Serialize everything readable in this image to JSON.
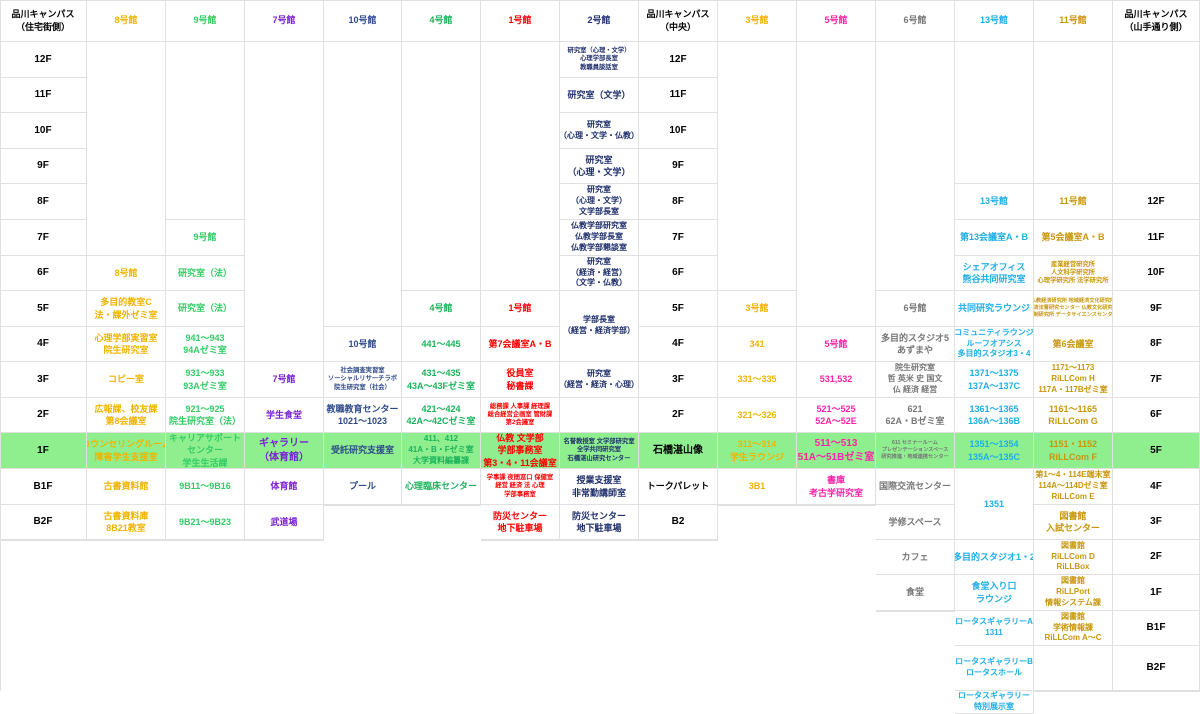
{
  "colors": {
    "b8": "#f0b400",
    "b9": "#33cc66",
    "b7": "#7a1fd6",
    "b10": "#2e4a8a",
    "b4": "#1bb35c",
    "b1": "#ff0000",
    "b2": "#1f2f6b",
    "b3": "#f0b400",
    "b5": "#ff22a8",
    "b6": "#777777",
    "b13": "#1eaee6",
    "b11": "#c8960a",
    "black": "#000000",
    "band": "#8fef8f",
    "grid": "#e0e0e0"
  },
  "columns": [
    {
      "key": "west_floor",
      "header": "品川キャンパス\n（住宅街側）",
      "color": "black"
    },
    {
      "key": "b8",
      "header": "8号館",
      "color": "b8"
    },
    {
      "key": "b9",
      "header": "9号館",
      "color": "b9"
    },
    {
      "key": "b7",
      "header": "7号館",
      "color": "b7"
    },
    {
      "key": "b10",
      "header": "10号館",
      "color": "b10"
    },
    {
      "key": "b4",
      "header": "4号館",
      "color": "b4"
    },
    {
      "key": "b1",
      "header": "1号館",
      "color": "b1"
    },
    {
      "key": "b2",
      "header": "2号館",
      "color": "b2"
    },
    {
      "key": "center_floor",
      "header": "品川キャンパス\n（中央）",
      "color": "black"
    },
    {
      "key": "b3",
      "header": "3号館",
      "color": "b3"
    },
    {
      "key": "b5",
      "header": "5号館",
      "color": "b5"
    },
    {
      "key": "b6",
      "header": "6号館",
      "color": "b6"
    },
    {
      "key": "b13",
      "header": "13号館",
      "color": "b13"
    },
    {
      "key": "b11",
      "header": "11号館",
      "color": "b11"
    },
    {
      "key": "east_floor",
      "header": "品川キャンパス\n（山手通り側）",
      "color": "black"
    }
  ],
  "cells": [
    {
      "col": 0,
      "row": 1,
      "text": "12F",
      "size": "lg"
    },
    {
      "col": 0,
      "row": 2,
      "text": "11F",
      "size": "lg"
    },
    {
      "col": 0,
      "row": 3,
      "text": "10F",
      "size": "lg"
    },
    {
      "col": 0,
      "row": 4,
      "text": "9F",
      "size": "lg"
    },
    {
      "col": 0,
      "row": 5,
      "text": "8F",
      "size": "lg"
    },
    {
      "col": 0,
      "row": 6,
      "text": "7F",
      "size": "lg"
    },
    {
      "col": 0,
      "row": 7,
      "text": "6F",
      "size": "lg"
    },
    {
      "col": 0,
      "row": 8,
      "text": "5F",
      "size": "lg"
    },
    {
      "col": 0,
      "row": 9,
      "text": "4F",
      "size": "lg"
    },
    {
      "col": 0,
      "row": 10,
      "text": "3F",
      "size": "lg"
    },
    {
      "col": 0,
      "row": 11,
      "text": "2F",
      "size": "lg"
    },
    {
      "col": 0,
      "row": 12,
      "text": "1F",
      "size": "lg"
    },
    {
      "col": 0,
      "row": 13,
      "text": "B1F",
      "size": "lg"
    },
    {
      "col": 0,
      "row": 14,
      "text": "B2F",
      "size": "lg"
    },
    {
      "col": 0,
      "row": 15,
      "rowspan": 5,
      "text": ""
    },
    {
      "col": 1,
      "row": 1,
      "rowspan": 6,
      "text": ""
    },
    {
      "col": 1,
      "row": 7,
      "text": "8号館"
    },
    {
      "col": 1,
      "row": 8,
      "text": "多目的教室C\n法・課外ゼミ室"
    },
    {
      "col": 1,
      "row": 9,
      "text": "心理学部実習室\n院生研究室"
    },
    {
      "col": 1,
      "row": 10,
      "text": "コピー室"
    },
    {
      "col": 1,
      "row": 11,
      "text": "広報課、校友課\n第8会議室"
    },
    {
      "col": 1,
      "row": 12,
      "text": "カウンセリングルーム\n障害学生支援室"
    },
    {
      "col": 1,
      "row": 13,
      "text": "古書資料館"
    },
    {
      "col": 1,
      "row": 14,
      "text": "古書資料庫\n8B21教室"
    },
    {
      "col": 1,
      "row": 15,
      "rowspan": 5,
      "text": ""
    },
    {
      "col": 2,
      "row": 1,
      "rowspan": 5,
      "text": ""
    },
    {
      "col": 2,
      "row": 6,
      "text": "9号館"
    },
    {
      "col": 2,
      "row": 7,
      "text": "研究室（法）"
    },
    {
      "col": 2,
      "row": 8,
      "text": "研究室（法）"
    },
    {
      "col": 2,
      "row": 9,
      "text": "941〜943\n94Aゼミ室"
    },
    {
      "col": 2,
      "row": 10,
      "text": "931〜933\n93Aゼミ室"
    },
    {
      "col": 2,
      "row": 11,
      "text": "921〜925\n院生研究室（法）"
    },
    {
      "col": 2,
      "row": 12,
      "text": "キャリアサポート\nセンター\n学生生活課"
    },
    {
      "col": 2,
      "row": 13,
      "text": "9B11〜9B16"
    },
    {
      "col": 2,
      "row": 14,
      "text": "9B21〜9B23"
    },
    {
      "col": 2,
      "row": 15,
      "rowspan": 5,
      "text": ""
    },
    {
      "col": 3,
      "row": 1,
      "rowspan": 9,
      "text": ""
    },
    {
      "col": 3,
      "row": 10,
      "text": "7号館"
    },
    {
      "col": 3,
      "row": 11,
      "text": "学生食堂"
    },
    {
      "col": 3,
      "row": 12,
      "text": "ギャラリー\n（体育館）",
      "size": "lg"
    },
    {
      "col": 3,
      "row": 13,
      "text": "体育館"
    },
    {
      "col": 3,
      "row": 14,
      "text": "武道場"
    },
    {
      "col": 3,
      "row": 15,
      "rowspan": 5,
      "text": ""
    },
    {
      "col": 4,
      "row": 1,
      "rowspan": 8,
      "text": ""
    },
    {
      "col": 4,
      "row": 9,
      "text": "10号館"
    },
    {
      "col": 4,
      "row": 10,
      "text": "社会調査実習室\nソーシャルリサーチラボ\n院生研究室（社会）",
      "size": "xs"
    },
    {
      "col": 4,
      "row": 11,
      "text": "教職教育センター\n1021〜1023"
    },
    {
      "col": 4,
      "row": 12,
      "text": "受託研究支援室"
    },
    {
      "col": 4,
      "row": 13,
      "text": "プール"
    },
    {
      "col": 4,
      "row": 14,
      "rowspan": 6,
      "text": ""
    },
    {
      "col": 5,
      "row": 1,
      "rowspan": 7,
      "text": ""
    },
    {
      "col": 5,
      "row": 8,
      "text": "4号館"
    },
    {
      "col": 5,
      "row": 9,
      "text": "441〜445"
    },
    {
      "col": 5,
      "row": 10,
      "text": "431〜435\n43A〜43Fゼミ室"
    },
    {
      "col": 5,
      "row": 11,
      "text": "421〜424\n42A〜42Cゼミ室"
    },
    {
      "col": 5,
      "row": 12,
      "text": "411、412\n41A・B・Fゼミ室\n大学資料編纂課",
      "size": "sm"
    },
    {
      "col": 5,
      "row": 13,
      "text": "心理臨床センター"
    },
    {
      "col": 5,
      "row": 14,
      "rowspan": 6,
      "text": ""
    },
    {
      "col": 6,
      "row": 1,
      "rowspan": 7,
      "text": ""
    },
    {
      "col": 6,
      "row": 8,
      "text": "1号館"
    },
    {
      "col": 6,
      "row": 9,
      "text": "第7会議室A・B"
    },
    {
      "col": 6,
      "row": 10,
      "text": "役員室\n秘書課"
    },
    {
      "col": 6,
      "row": 11,
      "text": "総務課 人事課 経理課\n総合経営企画室 管財課\n第2会議室",
      "size": "xs"
    },
    {
      "col": 6,
      "row": 12,
      "text": "仏教 文学部\n学部事務室\n第3・4・11会議室"
    },
    {
      "col": 6,
      "row": 13,
      "text": "学事課 夜間窓口 保健室\n経営 経済 法 心理\n学部事務室",
      "size": "xs"
    },
    {
      "col": 6,
      "row": 14,
      "text": "防災センター\n地下駐車場"
    },
    {
      "col": 6,
      "row": 15,
      "rowspan": 5,
      "text": ""
    },
    {
      "col": 7,
      "row": 1,
      "text": "研究室（心理・文学）\n心理学部長室\n教職員談話室",
      "size": "xs"
    },
    {
      "col": 7,
      "row": 2,
      "text": "研究室（文学）"
    },
    {
      "col": 7,
      "row": 3,
      "text": "研究室\n（心理・文学・仏教）",
      "size": "sm"
    },
    {
      "col": 7,
      "row": 4,
      "text": "研究室\n（心理・文学）"
    },
    {
      "col": 7,
      "row": 5,
      "text": "研究室\n（心理・文学）\n文学部長室",
      "size": "sm"
    },
    {
      "col": 7,
      "row": 6,
      "text": "仏教学部研究室\n仏教学部長室\n仏教学部懇談室",
      "size": "sm"
    },
    {
      "col": 7,
      "row": 7,
      "text": "研究室\n（経済・経営）\n（文学・仏教）",
      "size": "sm"
    },
    {
      "col": 7,
      "row": 8,
      "rowspan": 2,
      "text": "学部長室\n（経営・経済学部）",
      "size": "sm"
    },
    {
      "col": 7,
      "row": 10,
      "text": "研究室\n（経営・経済・心理）",
      "size": "sm"
    },
    {
      "col": 7,
      "row": 11,
      "text": ""
    },
    {
      "col": 7,
      "row": 12,
      "text": "名誉教授室 文学部研究室\n全学共同研究室\n石橋湛山研究センター",
      "size": "xs"
    },
    {
      "col": 7,
      "row": 13,
      "text": "授業支援室\n非常勤講師室"
    },
    {
      "col": 7,
      "row": 14,
      "text": "防災センター\n地下駐車場"
    },
    {
      "col": 7,
      "row": 15,
      "rowspan": 5,
      "text": ""
    },
    {
      "col": 8,
      "row": 1,
      "text": "12F",
      "size": "lg"
    },
    {
      "col": 8,
      "row": 2,
      "text": "11F",
      "size": "lg"
    },
    {
      "col": 8,
      "row": 3,
      "text": "10F",
      "size": "lg"
    },
    {
      "col": 8,
      "row": 4,
      "text": "9F",
      "size": "lg"
    },
    {
      "col": 8,
      "row": 5,
      "text": "8F",
      "size": "lg"
    },
    {
      "col": 8,
      "row": 6,
      "text": "7F",
      "size": "lg"
    },
    {
      "col": 8,
      "row": 7,
      "text": "6F",
      "size": "lg"
    },
    {
      "col": 8,
      "row": 8,
      "text": "5F",
      "size": "lg"
    },
    {
      "col": 8,
      "row": 9,
      "text": "4F",
      "size": "lg"
    },
    {
      "col": 8,
      "row": 10,
      "text": "3F",
      "size": "lg"
    },
    {
      "col": 8,
      "row": 11,
      "text": "2F",
      "size": "lg"
    },
    {
      "col": 8,
      "row": 12,
      "text": "石橋湛山像",
      "size": "lg"
    },
    {
      "col": 8,
      "row": 13,
      "text": "トークパレット"
    },
    {
      "col": 8,
      "row": 14,
      "text": "B2",
      "size": "lg"
    },
    {
      "col": 8,
      "row": 15,
      "rowspan": 5,
      "text": ""
    },
    {
      "col": 9,
      "row": 1,
      "rowspan": 7,
      "text": ""
    },
    {
      "col": 9,
      "row": 8,
      "text": "3号館"
    },
    {
      "col": 9,
      "row": 9,
      "text": "341"
    },
    {
      "col": 9,
      "row": 10,
      "text": "331〜335"
    },
    {
      "col": 9,
      "row": 11,
      "text": "321〜326"
    },
    {
      "col": 9,
      "row": 12,
      "text": "311〜314\n学生ラウンジ"
    },
    {
      "col": 9,
      "row": 13,
      "text": "3B1"
    },
    {
      "col": 9,
      "row": 14,
      "rowspan": 6,
      "text": ""
    },
    {
      "col": 10,
      "row": 1,
      "rowspan": 8,
      "text": ""
    },
    {
      "col": 10,
      "row": 9,
      "text": "5号館"
    },
    {
      "col": 10,
      "row": 10,
      "text": "531,532"
    },
    {
      "col": 10,
      "row": 11,
      "text": "521〜525\n52A〜52E"
    },
    {
      "col": 10,
      "row": 12,
      "text": "511〜513\n51A〜51Bゼミ室",
      "size": "lg"
    },
    {
      "col": 10,
      "row": 13,
      "text": "書庫\n考古学研究室"
    },
    {
      "col": 10,
      "row": 14,
      "rowspan": 6,
      "text": ""
    },
    {
      "col": 11,
      "row": 1,
      "rowspan": 7,
      "text": ""
    },
    {
      "col": 11,
      "row": 8,
      "text": "6号館"
    },
    {
      "col": 11,
      "row": 9,
      "text": "多目的スタジオ5\nあずまや"
    },
    {
      "col": 11,
      "row": 10,
      "text": "院生研究室\n哲 英米 史 国文\n仏 経済 経営",
      "size": "sm"
    },
    {
      "col": 11,
      "row": 11,
      "text": "621\n62A・Bゼミ室"
    },
    {
      "col": 11,
      "row": 12,
      "text": "611 セミナールーム\nプレゼンテーションスペース\n研究推進・地域連携センター",
      "size": "xxs"
    },
    {
      "col": 11,
      "row": 13,
      "text": "国際交流センター"
    },
    {
      "col": 11,
      "row": 14,
      "text": "学修スペース"
    },
    {
      "col": 11,
      "row": 15,
      "text": "カフェ"
    },
    {
      "col": 11,
      "row": 16,
      "text": "食堂"
    },
    {
      "col": 11,
      "row": 17,
      "rowspan": 3,
      "text": ""
    },
    {
      "col": 12,
      "row": 1,
      "rowspan": 4,
      "text": ""
    },
    {
      "col": 12,
      "row": 5,
      "text": "13号館"
    },
    {
      "col": 12,
      "row": 6,
      "text": "第13会議室A・B"
    },
    {
      "col": 12,
      "row": 7,
      "text": "シェアオフィス\n熊谷共同研究室"
    },
    {
      "col": 12,
      "row": 8,
      "text": "共同研究ラウンジ"
    },
    {
      "col": 12,
      "row": 9,
      "text": "コミュニティラウンジ\nルーフオアシス\n多目的スタジオ3・4",
      "size": "sm"
    },
    {
      "col": 12,
      "row": 10,
      "text": "1371〜1375\n137A〜137C"
    },
    {
      "col": 12,
      "row": 11,
      "text": "1361〜1365\n136A〜136B"
    },
    {
      "col": 12,
      "row": 12,
      "text": "1351〜1354\n135A〜135C"
    },
    {
      "col": 12,
      "row": 13,
      "rowspan": 2,
      "text": "1351"
    },
    {
      "col": 12,
      "row": 15,
      "text": "多目的スタジオ1・2"
    },
    {
      "col": 12,
      "row": 16,
      "text": "食堂入り口\nラウンジ"
    },
    {
      "col": 12,
      "row": 17,
      "text": "ロータスギャラリーA\n1311",
      "size": "sm"
    },
    {
      "col": 12,
      "row": 18,
      "text": "ロータスギャラリーB\nロータスホール",
      "size": "sm"
    },
    {
      "col": 12,
      "row": 19,
      "text": "ロータスギャラリー\n特別展示室",
      "size": "sm"
    },
    {
      "col": 13,
      "row": 1,
      "rowspan": 4,
      "text": ""
    },
    {
      "col": 13,
      "row": 5,
      "text": "11号館"
    },
    {
      "col": 13,
      "row": 6,
      "text": "第5会議室A・B"
    },
    {
      "col": 13,
      "row": 7,
      "text": "産業経営研究所\n人文科学研究所\n心理学研究所 法学研究所",
      "size": "xs"
    },
    {
      "col": 13,
      "row": 8,
      "text": "仏教経済研究所 地域経済文化研究所\n経済法曹研究センター 仏教文化研究所\n法制研究所 データサイエンスセンター",
      "size": "xxs"
    },
    {
      "col": 13,
      "row": 9,
      "text": "第6会議室"
    },
    {
      "col": 13,
      "row": 10,
      "text": "1171〜1173\nRiLLCom H\n117A・117Bゼミ室",
      "size": "sm"
    },
    {
      "col": 13,
      "row": 11,
      "text": "1161〜1165\nRiLLCom G"
    },
    {
      "col": 13,
      "row": 12,
      "text": "1151・1152\nRiLLCom F"
    },
    {
      "col": 13,
      "row": 13,
      "text": "第1〜4・114E端末室\n114A〜114Dゼミ室\nRiLLCom E",
      "size": "sm"
    },
    {
      "col": 13,
      "row": 14,
      "text": "図書館\n入試センター"
    },
    {
      "col": 13,
      "row": 15,
      "text": "図書館\nRiLLCom D\nRiLLBox",
      "size": "sm"
    },
    {
      "col": 13,
      "row": 16,
      "text": "図書館\nRiLLPort\n情報システム課",
      "size": "sm"
    },
    {
      "col": 13,
      "row": 17,
      "text": "図書館\n学術情報課\nRiLLCom A〜C",
      "size": "sm"
    },
    {
      "col": 13,
      "row": 18,
      "text": ""
    },
    {
      "col": 13,
      "row": 19,
      "text": ""
    },
    {
      "col": 14,
      "row": 1,
      "rowspan": 4,
      "text": ""
    },
    {
      "col": 14,
      "row": 5,
      "text": "12F",
      "size": "lg"
    },
    {
      "col": 14,
      "row": 6,
      "text": "11F",
      "size": "lg"
    },
    {
      "col": 14,
      "row": 7,
      "text": "10F",
      "size": "lg"
    },
    {
      "col": 14,
      "row": 8,
      "text": "9F",
      "size": "lg"
    },
    {
      "col": 14,
      "row": 9,
      "text": "8F",
      "size": "lg"
    },
    {
      "col": 14,
      "row": 10,
      "text": "7F",
      "size": "lg"
    },
    {
      "col": 14,
      "row": 11,
      "text": "6F",
      "size": "lg"
    },
    {
      "col": 14,
      "row": 12,
      "text": "5F",
      "size": "lg"
    },
    {
      "col": 14,
      "row": 13,
      "text": "4F",
      "size": "lg"
    },
    {
      "col": 14,
      "row": 14,
      "text": "3F",
      "size": "lg"
    },
    {
      "col": 14,
      "row": 15,
      "text": "2F",
      "size": "lg"
    },
    {
      "col": 14,
      "row": 16,
      "text": "1F",
      "size": "lg"
    },
    {
      "col": 14,
      "row": 17,
      "text": "B1F",
      "size": "lg"
    },
    {
      "col": 14,
      "row": 18,
      "text": "B2F",
      "size": "lg"
    },
    {
      "col": 14,
      "row": 19,
      "text": ""
    }
  ]
}
